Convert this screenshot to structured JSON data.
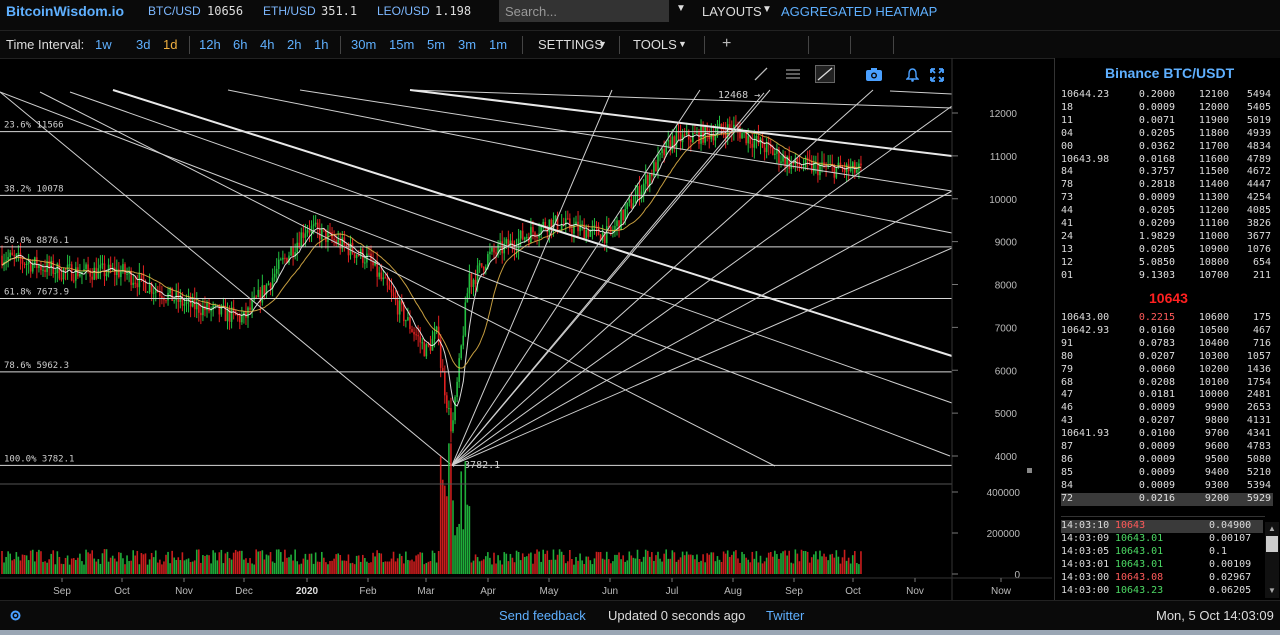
{
  "header": {
    "brand": "BitcoinWisdom.io",
    "tickers": [
      {
        "label": "BTC/USD",
        "value": "10656"
      },
      {
        "label": "ETH/USD",
        "value": "351.1"
      },
      {
        "label": "LEO/USD",
        "value": "1.198"
      }
    ],
    "search_placeholder": "Search...",
    "layouts_label": "LAYOUTS",
    "heatmap_label": "AGGREGATED HEATMAP"
  },
  "toolbar": {
    "time_interval_label": "Time Interval:",
    "intervals": [
      "1w",
      "3d",
      "1d",
      "12h",
      "6h",
      "4h",
      "2h",
      "1h",
      "30m",
      "15m",
      "5m",
      "3m",
      "1m"
    ],
    "active_interval": "1d",
    "settings_label": "SETTINGS",
    "tools_label": "TOOLS",
    "icons": [
      "crosshair-icon",
      "line-tool-icon",
      "hline-tool-icon",
      "trendline-tool-icon",
      "camera-icon",
      "bell-icon",
      "fullscreen-icon"
    ]
  },
  "chart": {
    "fib_levels": [
      {
        "label": "23.6% 11566",
        "price": 11566
      },
      {
        "label": "38.2% 10078",
        "price": 10078
      },
      {
        "label": "50.0% 8876.1",
        "price": 8876.1
      },
      {
        "label": "61.8% 7673.9",
        "price": 7673.9
      },
      {
        "label": "78.6% 5962.3",
        "price": 5962.3
      },
      {
        "label": "100.0% 3782.1",
        "price": 3782.1
      }
    ],
    "high_annotation": "12468 →",
    "low_annotation": "← 3782.1",
    "price_axis": [
      "12000",
      "11000",
      "10000",
      "9000",
      "8000",
      "7000",
      "6000",
      "5000",
      "4000"
    ],
    "volume_axis": [
      "400000",
      "200000",
      "0"
    ],
    "time_axis": [
      "Sep",
      "Oct",
      "Nov",
      "Dec",
      "2020",
      "Feb",
      "Mar",
      "Apr",
      "May",
      "Jun",
      "Jul",
      "Aug",
      "Sep",
      "Oct",
      "Nov",
      "Now"
    ],
    "colors": {
      "up": "#22c040",
      "down": "#e02020",
      "ma_fast": "#ffffff",
      "ma_slow": "#e8b84a",
      "lines": "#cfcfcf"
    }
  },
  "chart_data": {
    "type": "candlestick",
    "title": "",
    "x": [
      "Sep 2019",
      "Oct 2019",
      "Nov 2019",
      "Dec 2019",
      "Jan 2020",
      "Feb 2020",
      "Mar 2020",
      "Apr 2020",
      "May 2020",
      "Jun 2020",
      "Jul 2020",
      "Aug 2020",
      "Sep 2020",
      "Oct 2020"
    ],
    "close": [
      8300,
      8300,
      7550,
      7200,
      9350,
      8600,
      6450,
      8650,
      9450,
      9150,
      11350,
      11650,
      10780,
      10656
    ],
    "ylim": [
      3600,
      12700
    ],
    "volume_ylim": [
      0,
      450000
    ],
    "fib_high": 12468,
    "fib_low": 3782.1
  },
  "orderbook": {
    "title": "Binance BTC/USDT",
    "asks": [
      {
        "price": "10644.23",
        "vol": "0.2000",
        "level": "12100",
        "sum": "5494"
      },
      {
        "price": "18",
        "vol": "0.0009",
        "level": "12000",
        "sum": "5405"
      },
      {
        "price": "11",
        "vol": "0.0071",
        "level": "11900",
        "sum": "5019"
      },
      {
        "price": "04",
        "vol": "0.0205",
        "level": "11800",
        "sum": "4939"
      },
      {
        "price": "00",
        "vol": "0.0362",
        "level": "11700",
        "sum": "4834"
      },
      {
        "price": "10643.98",
        "vol": "0.0168",
        "level": "11600",
        "sum": "4789"
      },
      {
        "price": "84",
        "vol": "0.3757",
        "level": "11500",
        "sum": "4672"
      },
      {
        "price": "78",
        "vol": "0.2818",
        "level": "11400",
        "sum": "4447"
      },
      {
        "price": "73",
        "vol": "0.0009",
        "level": "11300",
        "sum": "4254"
      },
      {
        "price": "44",
        "vol": "0.0205",
        "level": "11200",
        "sum": "4085"
      },
      {
        "price": "41",
        "vol": "0.0209",
        "level": "11100",
        "sum": "3826"
      },
      {
        "price": "24",
        "vol": "1.9829",
        "level": "11000",
        "sum": "3677"
      },
      {
        "price": "13",
        "vol": "0.0205",
        "level": "10900",
        "sum": "1076"
      },
      {
        "price": "12",
        "vol": "5.0850",
        "level": "10800",
        "sum": "654"
      },
      {
        "price": "01",
        "vol": "9.1303",
        "level": "10700",
        "sum": "211"
      }
    ],
    "mid_price": "10643",
    "bids": [
      {
        "price": "10643.00",
        "vol": "0.2215",
        "level": "10600",
        "sum": "175"
      },
      {
        "price": "10642.93",
        "vol": "0.0160",
        "level": "10500",
        "sum": "467"
      },
      {
        "price": "91",
        "vol": "0.0783",
        "level": "10400",
        "sum": "716"
      },
      {
        "price": "80",
        "vol": "0.0207",
        "level": "10300",
        "sum": "1057"
      },
      {
        "price": "79",
        "vol": "0.0060",
        "level": "10200",
        "sum": "1436"
      },
      {
        "price": "68",
        "vol": "0.0208",
        "level": "10100",
        "sum": "1754"
      },
      {
        "price": "47",
        "vol": "0.0181",
        "level": "10000",
        "sum": "2481"
      },
      {
        "price": "46",
        "vol": "0.0009",
        "level": "9900",
        "sum": "2653"
      },
      {
        "price": "43",
        "vol": "0.0207",
        "level": "9800",
        "sum": "4131"
      },
      {
        "price": "10641.93",
        "vol": "0.0100",
        "level": "9700",
        "sum": "4341"
      },
      {
        "price": "87",
        "vol": "0.0009",
        "level": "9600",
        "sum": "4783"
      },
      {
        "price": "86",
        "vol": "0.0009",
        "level": "9500",
        "sum": "5080"
      },
      {
        "price": "85",
        "vol": "0.0009",
        "level": "9400",
        "sum": "5210"
      },
      {
        "price": "84",
        "vol": "0.0009",
        "level": "9300",
        "sum": "5394"
      },
      {
        "price": "72",
        "vol": "0.0216",
        "level": "9200",
        "sum": "5929"
      }
    ]
  },
  "trades": [
    {
      "time": "14:03:10",
      "price": "10643",
      "amount": "0.04900",
      "side": "sell"
    },
    {
      "time": "14:03:09",
      "price": "10643.01",
      "amount": "0.00107",
      "side": "buy"
    },
    {
      "time": "14:03:05",
      "price": "10643.01",
      "amount": "0.1",
      "side": "buy"
    },
    {
      "time": "14:03:01",
      "price": "10643.01",
      "amount": "0.00109",
      "side": "buy"
    },
    {
      "time": "14:03:00",
      "price": "10643.08",
      "amount": "0.02967",
      "side": "sell"
    },
    {
      "time": "14:03:00",
      "price": "10643.23",
      "amount": "0.06205",
      "side": "buy"
    }
  ],
  "footer": {
    "send_feedback": "Send feedback",
    "updated": "Updated 0 seconds ago",
    "twitter": "Twitter",
    "datetime": "Mon, 5 Oct 14:03:09"
  }
}
